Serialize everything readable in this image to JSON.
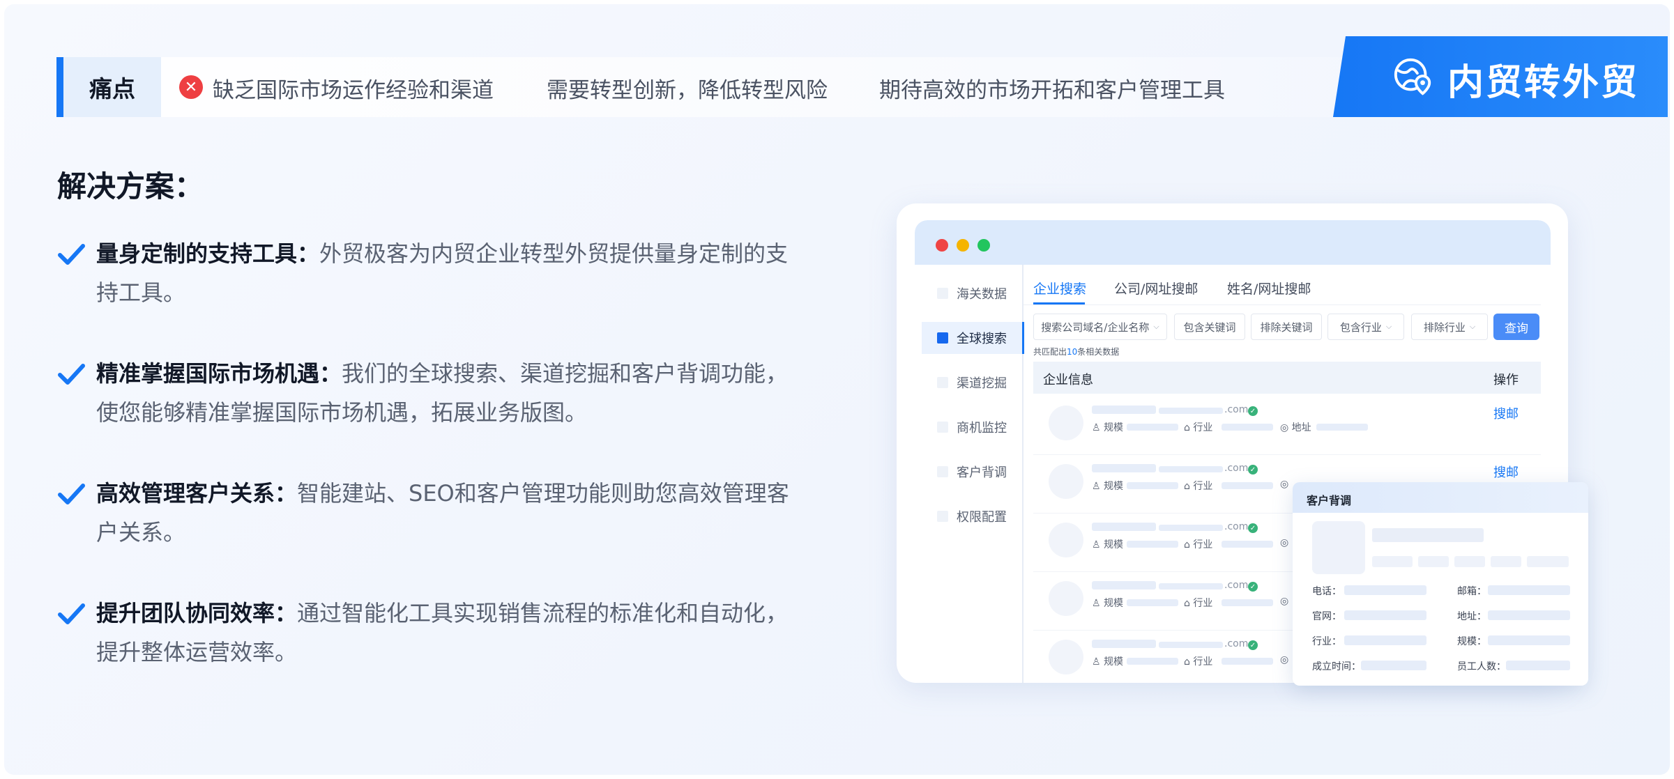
{
  "pain_points": {
    "label": "痛点",
    "items": [
      "缺乏国际市场运作经验和渠道",
      "需要转型创新，降低转型风险",
      "期待高效的市场开拓和客户管理工具"
    ]
  },
  "badge": {
    "text": "内贸转外贸",
    "icon": "globe-location-icon"
  },
  "solutions": {
    "title": "解决方案：",
    "features": [
      {
        "title": "量身定制的支持工具：",
        "text": "外贸极客为内贸企业转型外贸提供量身定制的支持工具。"
      },
      {
        "title": "精准掌握国际市场机遇：",
        "text": "我们的全球搜索、渠道挖掘和客户背调功能，使您能够精准掌握国际市场机遇，拓展业务版图。"
      },
      {
        "title": "高效管理客户关系：",
        "text": "智能建站、SEO和客户管理功能则助您高效管理客户关系。"
      },
      {
        "title": "提升团队协同效率：",
        "text": "通过智能化工具实现销售流程的标准化和自动化，提升整体运营效率。"
      }
    ]
  },
  "app": {
    "window_dots": [
      "#ef4444",
      "#f5b400",
      "#22c55e"
    ],
    "sidebar": [
      "海关数据",
      "全球搜索",
      "渠道挖掘",
      "商机监控",
      "客户背调",
      "权限配置"
    ],
    "sidebar_active_index": 1,
    "tabs": [
      "企业搜索",
      "公司/网址搜邮",
      "姓名/网址搜邮"
    ],
    "filters": {
      "search_placeholder": "搜索公司域名/企业名称",
      "include_keyword": "包含关键词",
      "exclude_keyword": "排除关键词",
      "include_industry": "包含行业",
      "exclude_industry": "排除行业",
      "query_button": "查询"
    },
    "matched": {
      "prefix": "共匹配出",
      "count": "10",
      "suffix": "条相关数据"
    },
    "table_headers": {
      "info": "企业信息",
      "action": "操作"
    },
    "row_labels": {
      "domain": ".com",
      "scale": "规模",
      "industry": "行业",
      "address": "地址",
      "action": "搜邮"
    },
    "popup": {
      "title": "客户背调",
      "fields": [
        "电话：",
        "邮箱：",
        "官网：",
        "地址：",
        "行业：",
        "规模：",
        "成立时间：",
        "员工人数："
      ]
    }
  },
  "colors": {
    "accent": "#1677f5",
    "error": "#ee3f42",
    "verified": "#38b27a"
  }
}
